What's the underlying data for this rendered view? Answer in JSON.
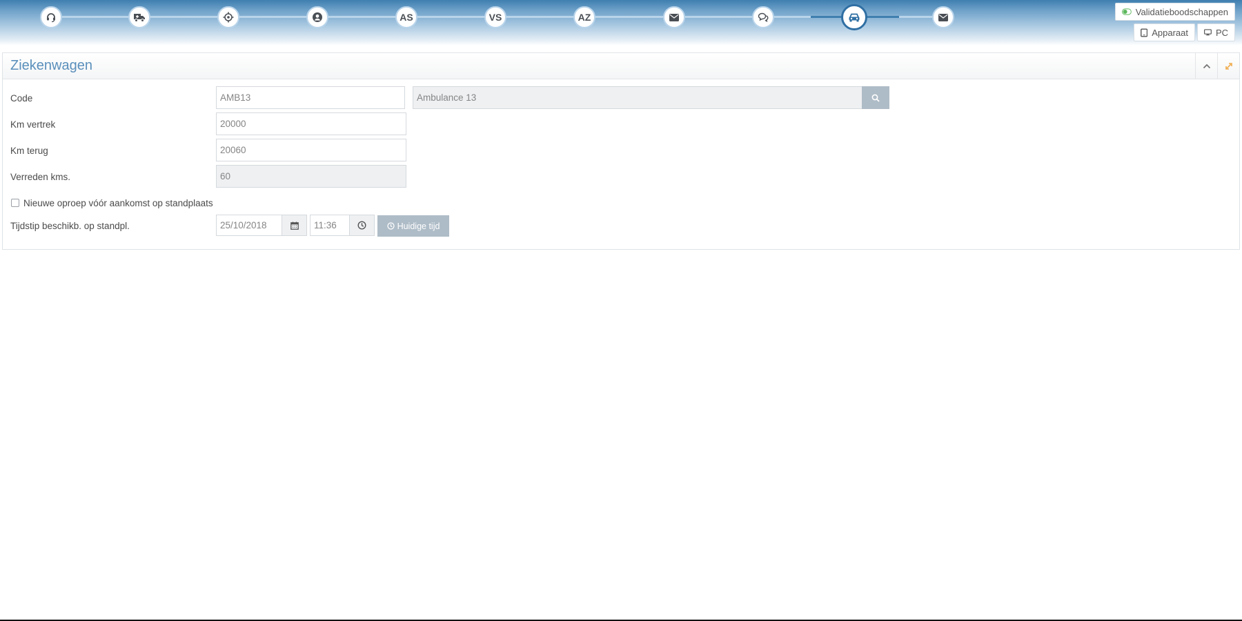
{
  "header": {
    "steps": [
      {
        "icon": "headset-icon",
        "text": ""
      },
      {
        "icon": "ambulance-icon",
        "text": ""
      },
      {
        "icon": "crosshair-icon",
        "text": ""
      },
      {
        "icon": "user-circle-icon",
        "text": ""
      },
      {
        "icon": "",
        "text": "AS"
      },
      {
        "icon": "",
        "text": "VS"
      },
      {
        "icon": "",
        "text": "AZ"
      },
      {
        "icon": "envelope-icon",
        "text": ""
      },
      {
        "icon": "chat-icon",
        "text": ""
      },
      {
        "icon": "car-icon",
        "text": "",
        "active": true
      },
      {
        "icon": "envelope-icon",
        "text": ""
      }
    ],
    "validation_label": "Validatieboodschappen",
    "device_label": "Apparaat",
    "pc_label": "PC"
  },
  "panel": {
    "title": "Ziekenwagen"
  },
  "form": {
    "code_label": "Code",
    "code_value": "AMB13",
    "code_description": "Ambulance 13",
    "km_departure_label": "Km vertrek",
    "km_departure_value": "20000",
    "km_return_label": "Km terug",
    "km_return_value": "20060",
    "distance_label": "Verreden kms.",
    "distance_value": "60",
    "new_call_label": "Nieuwe oproep vóór aankomst op standplaats",
    "new_call_checked": false,
    "availability_label": "Tijdstip beschikb. op standpl.",
    "availability_date": "25/10/2018",
    "availability_time": "11:36",
    "current_time_button": "Huidige tijd"
  },
  "colors": {
    "accent": "#3f7fb0",
    "title": "#5a8fbb",
    "button_gray": "#aebcc7",
    "toggle_green": "#5cb85c",
    "expand_orange": "#f0ad4e"
  }
}
